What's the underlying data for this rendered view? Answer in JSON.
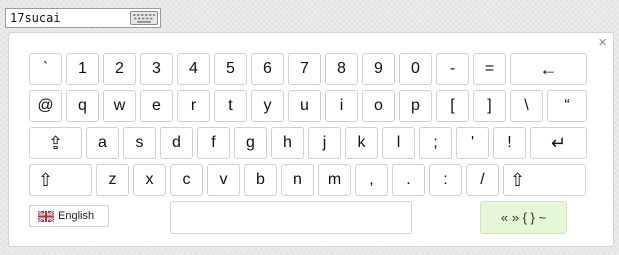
{
  "input": {
    "value": "17sucai"
  },
  "keyboard": {
    "close_symbol": "×",
    "rows": [
      [
        {
          "label": "`",
          "name": "key-backtick"
        },
        {
          "label": "1",
          "name": "key-1"
        },
        {
          "label": "2",
          "name": "key-2"
        },
        {
          "label": "3",
          "name": "key-3"
        },
        {
          "label": "4",
          "name": "key-4"
        },
        {
          "label": "5",
          "name": "key-5"
        },
        {
          "label": "6",
          "name": "key-6"
        },
        {
          "label": "7",
          "name": "key-7"
        },
        {
          "label": "8",
          "name": "key-8"
        },
        {
          "label": "9",
          "name": "key-9"
        },
        {
          "label": "0",
          "name": "key-0"
        },
        {
          "label": "-",
          "name": "key-minus"
        },
        {
          "label": "=",
          "name": "key-equals"
        },
        {
          "label": "←",
          "name": "backspace-key",
          "icon": "backspace-arrow-icon"
        }
      ],
      [
        {
          "label": "@",
          "name": "key-at"
        },
        {
          "label": "q",
          "name": "key-q"
        },
        {
          "label": "w",
          "name": "key-w"
        },
        {
          "label": "e",
          "name": "key-e"
        },
        {
          "label": "r",
          "name": "key-r"
        },
        {
          "label": "t",
          "name": "key-t"
        },
        {
          "label": "y",
          "name": "key-y"
        },
        {
          "label": "u",
          "name": "key-u"
        },
        {
          "label": "i",
          "name": "key-i"
        },
        {
          "label": "o",
          "name": "key-o"
        },
        {
          "label": "p",
          "name": "key-p"
        },
        {
          "label": "[",
          "name": "key-left-bracket"
        },
        {
          "label": "]",
          "name": "key-right-bracket"
        },
        {
          "label": "\\",
          "name": "key-backslash"
        },
        {
          "label": "“",
          "name": "key-quote"
        }
      ],
      [
        {
          "label": "⇪",
          "name": "caps-lock-key",
          "icon": "caps-lock-icon"
        },
        {
          "label": "a",
          "name": "key-a"
        },
        {
          "label": "s",
          "name": "key-s"
        },
        {
          "label": "d",
          "name": "key-d"
        },
        {
          "label": "f",
          "name": "key-f"
        },
        {
          "label": "g",
          "name": "key-g"
        },
        {
          "label": "h",
          "name": "key-h"
        },
        {
          "label": "j",
          "name": "key-j"
        },
        {
          "label": "k",
          "name": "key-k"
        },
        {
          "label": "l",
          "name": "key-l"
        },
        {
          "label": ";",
          "name": "key-semicolon"
        },
        {
          "label": "'",
          "name": "key-apostrophe"
        },
        {
          "label": "!",
          "name": "key-exclamation"
        },
        {
          "label": "↵",
          "name": "enter-key",
          "icon": "enter-icon"
        }
      ],
      [
        {
          "label": "⇧",
          "name": "left-shift-key",
          "icon": "shift-icon"
        },
        {
          "label": "z",
          "name": "key-z"
        },
        {
          "label": "x",
          "name": "key-x"
        },
        {
          "label": "c",
          "name": "key-c"
        },
        {
          "label": "v",
          "name": "key-v"
        },
        {
          "label": "b",
          "name": "key-b"
        },
        {
          "label": "n",
          "name": "key-n"
        },
        {
          "label": "m",
          "name": "key-m"
        },
        {
          "label": ",",
          "name": "key-comma"
        },
        {
          "label": ".",
          "name": "key-period"
        },
        {
          "label": ":",
          "name": "key-colon"
        },
        {
          "label": "/",
          "name": "key-slash"
        },
        {
          "label": "⇧",
          "name": "right-shift-key",
          "icon": "shift-icon"
        }
      ]
    ],
    "language": {
      "label": "English",
      "flag": "uk-flag-icon"
    },
    "symbols_label": "« » { } ~"
  }
}
